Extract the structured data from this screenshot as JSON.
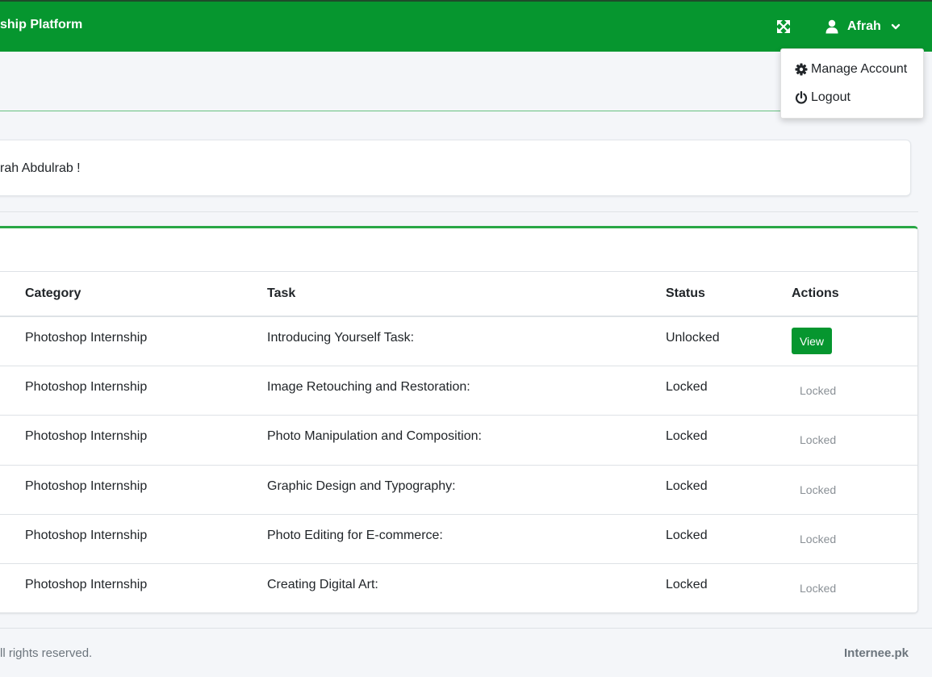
{
  "topbar": {
    "brand": "ship Platform",
    "user_name": "Afrah"
  },
  "icons": {
    "fullscreen": "expand-arrows-icon",
    "user": "user-icon",
    "chevron": "chevron-down-icon",
    "cog": "cog-icon",
    "power": "power-icon"
  },
  "welcome": {
    "text": "rah Abdulrab !"
  },
  "table": {
    "headers": {
      "category": "Category",
      "task": "Task",
      "status": "Status",
      "actions": "Actions"
    },
    "rows": [
      {
        "category": "Photoshop Internship",
        "task": "Introducing Yourself Task:",
        "status": "Unlocked",
        "action": "View"
      },
      {
        "category": "Photoshop Internship",
        "task": "Image Retouching and Restoration:",
        "status": "Locked",
        "action": "Locked"
      },
      {
        "category": "Photoshop Internship",
        "task": "Photo Manipulation and Composition:",
        "status": "Locked",
        "action": "Locked"
      },
      {
        "category": "Photoshop Internship",
        "task": "Graphic Design and Typography:",
        "status": "Locked",
        "action": "Locked"
      },
      {
        "category": "Photoshop Internship",
        "task": "Photo Editing for E-commerce:",
        "status": "Locked",
        "action": "Locked"
      },
      {
        "category": "Photoshop Internship",
        "task": "Creating Digital Art:",
        "status": "Locked",
        "action": "Locked"
      }
    ]
  },
  "footer": {
    "left": "ll rights reserved.",
    "right": "Internee.pk"
  },
  "dropdown": {
    "manage_account": "Manage Account",
    "logout": "Logout"
  },
  "colors": {
    "brand_green": "#06962f",
    "accent_green": "#28a745"
  }
}
